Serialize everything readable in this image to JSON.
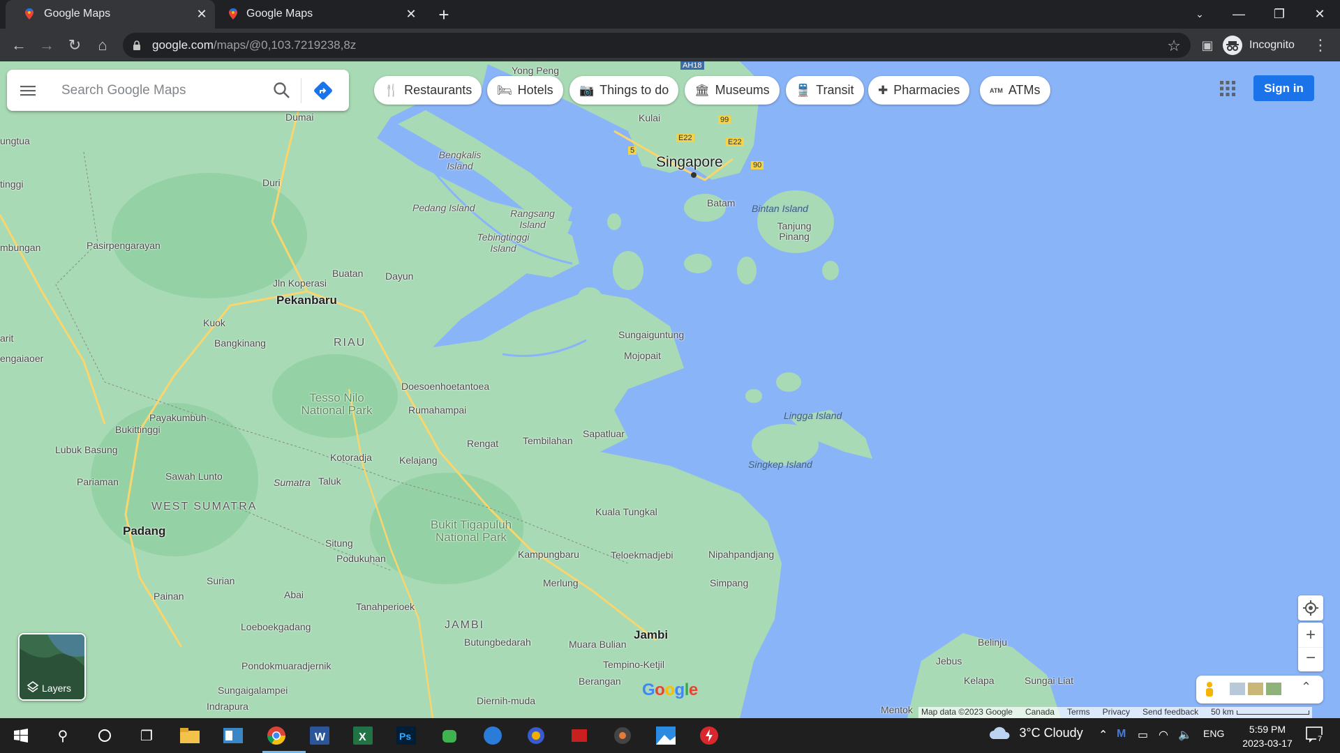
{
  "browser": {
    "tabs": [
      {
        "title": "Google Maps",
        "active": true
      },
      {
        "title": "Google Maps",
        "active": false
      }
    ],
    "url_host": "google.com",
    "url_path": "/maps/@0,103.7219238,8z",
    "profile_label": "Incognito"
  },
  "maps": {
    "search_placeholder": "Search Google Maps",
    "chips": [
      {
        "label": "Restaurants",
        "icon": "fork-knife-icon",
        "glyph": "🍴"
      },
      {
        "label": "Hotels",
        "icon": "bed-icon",
        "glyph": "🛏"
      },
      {
        "label": "Things to do",
        "icon": "camera-icon",
        "glyph": "📷"
      },
      {
        "label": "Museums",
        "icon": "museum-icon",
        "glyph": "🏛"
      },
      {
        "label": "Transit",
        "icon": "train-icon",
        "glyph": "🚆"
      },
      {
        "label": "Pharmacies",
        "icon": "pharmacy-icon",
        "glyph": "✚"
      },
      {
        "label": "ATMs",
        "icon": "atm-icon",
        "glyph": "ATM"
      }
    ],
    "sign_in": "Sign in",
    "layers_label": "Layers",
    "logo": "Google",
    "footer": [
      "Map data ©2023 Google",
      "Canada",
      "Terms",
      "Privacy",
      "Send feedback",
      "50 km"
    ],
    "labels": {
      "singapore": "Singapore",
      "pekanbaru": "Pekanbaru",
      "padang": "Padang",
      "jambi": "Jambi",
      "riau": "RIAU",
      "west_sumatra": "WEST SUMATRA",
      "jambi_region": "JAMBI",
      "tesso_nilo": "Tesso Nilo National Park",
      "bukit": "Bukit Tigapuluh National Park",
      "bengkalis": "Bengkalis Island",
      "pedang": "Pedang Island",
      "rangsang": "Rangsang Island",
      "tebingtinggi": "Tebingtinggi Island",
      "bintan": "Bintan Island",
      "lingga": "Lingga Island",
      "singkep": "Singkep Island",
      "batam": "Batam",
      "tanjung_pinang": "Tanjung Pinang",
      "kulai": "Kulai",
      "yong_peng": "Yong Peng",
      "dumai": "Dumai",
      "duri": "Duri",
      "buatan": "Buatan",
      "dayun": "Dayun",
      "jln_koperasi": "Jln Koperasi",
      "kuok": "Kuok",
      "bangkinang": "Bangkinang",
      "pasirpengarayan": "Pasirpengarayan",
      "payakumbuh": "Payakumbuh",
      "bukittinggi": "Bukittinggi",
      "lubuk_basung": "Lubuk Basung",
      "sawah_lunto": "Sawah Lunto",
      "pariaman": "Pariaman",
      "sumatra": "Sumatra",
      "taluk": "Taluk",
      "kotoradja": "Kotoradja",
      "kelajang": "Kelajang",
      "rengat": "Rengat",
      "rumahampai": "Rumahampai",
      "doesoenhoetantoea": "Doesoenhoetantoea",
      "tembilahan": "Tembilahan",
      "sapatluar": "Sapatluar",
      "sungaiguntung": "Sungaiguntung",
      "mojopait": "Mojopait",
      "kuala_tungkal": "Kuala Tungkal",
      "kampungbaru": "Kampungbaru",
      "teloekmadjebi": "Teloekmadjebi",
      "nipahpandjang": "Nipahpandjang",
      "simpang": "Simpang",
      "merlung": "Merlung",
      "situng": "Situng",
      "podukuhan": "Podukuhan",
      "surian": "Surian",
      "abai": "Abai",
      "painan": "Painan",
      "tanahperioek": "Tanahperioek",
      "loeboekgadang": "Loeboekgadang",
      "butungbedarah": "Butungbedarah",
      "muara_bulian": "Muara Bulian",
      "tempino": "Tempino-Ketjil",
      "berangan": "Berangan",
      "diernih": "Diernih-muda",
      "pondok": "Pondokmuaradjernik",
      "sungaigalampei": "Sungaigalampei",
      "indrapura": "Indrapura",
      "mentok": "Mentok",
      "belinju": "Belinju",
      "jebus": "Jebus",
      "kelapa": "Kelapa",
      "sungai_liat": "Sungai Liat",
      "ungtua": "ungtua",
      "tinggi": "tinggi",
      "mbungan": "mbungan",
      "arit": "arit",
      "engaiaoer": "engaiaoer",
      "highway_ah18": "AH18",
      "hw_99": "99",
      "hw_e22a": "E22",
      "hw_e22b": "E22",
      "hw_5": "5",
      "hw_90": "90"
    }
  },
  "taskbar": {
    "weather": "3°C  Cloudy",
    "lang": "ENG",
    "time": "5:59 PM",
    "date": "2023-03-17",
    "notifications": "7"
  },
  "colors": {
    "water": "#8ab4f8",
    "land": "#a8dab5",
    "land_dark": "#94d2a5",
    "accent": "#1a73e8"
  }
}
